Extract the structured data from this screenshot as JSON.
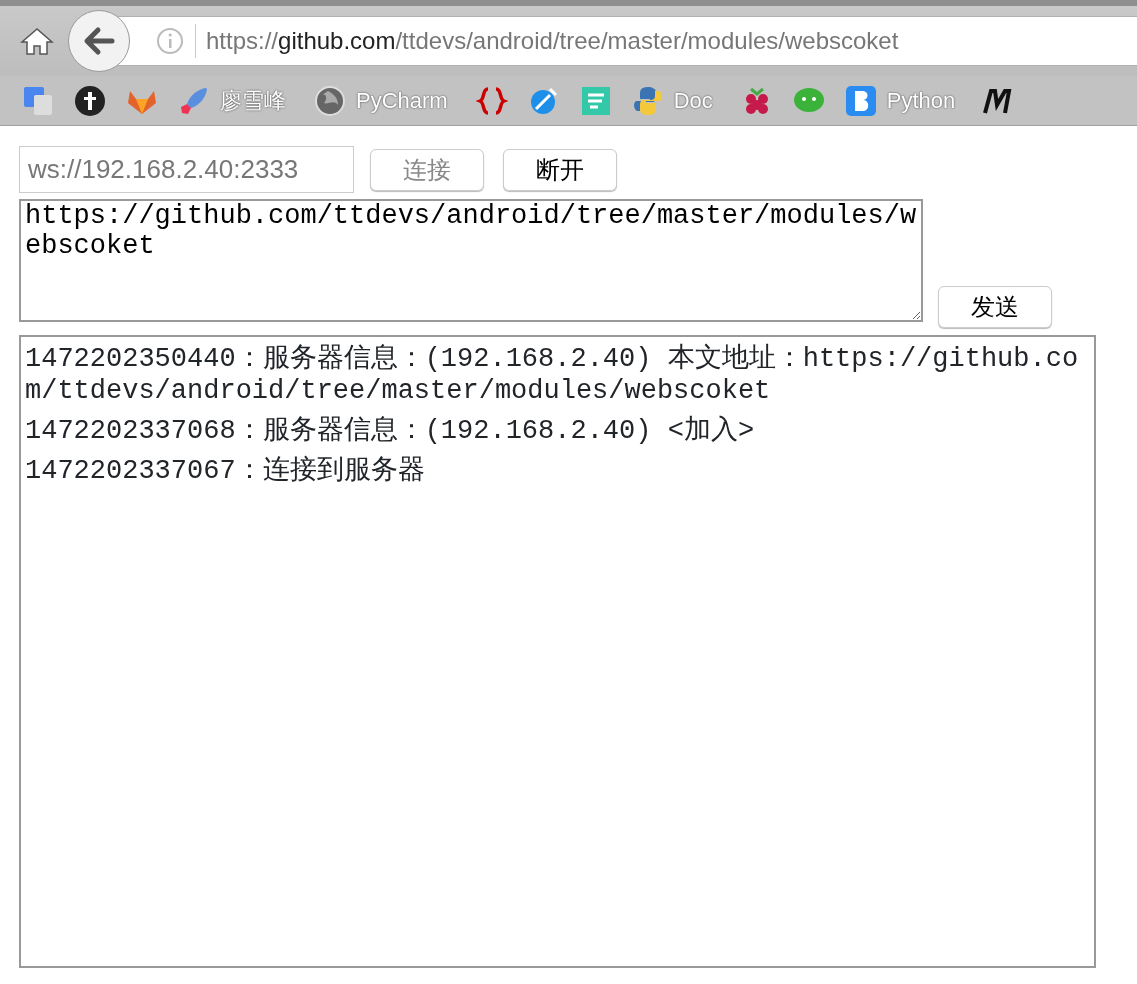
{
  "browser": {
    "url": {
      "scheme": "https://",
      "host": "github.com",
      "path": "/ttdevs/android/tree/master/modules/webscoket"
    },
    "bookmarks": [
      {
        "kind": "icon"
      },
      {
        "kind": "icon"
      },
      {
        "kind": "icon"
      },
      {
        "kind": "labeled",
        "label": "廖雪峰"
      },
      {
        "kind": "labeled",
        "label": "PyCharm"
      },
      {
        "kind": "icon"
      },
      {
        "kind": "icon"
      },
      {
        "kind": "icon"
      },
      {
        "kind": "labeled",
        "label": "Doc"
      },
      {
        "kind": "icon"
      },
      {
        "kind": "icon"
      },
      {
        "kind": "labeled",
        "label": "Python"
      },
      {
        "kind": "icon"
      }
    ]
  },
  "server_field": {
    "value": "ws://192.168.2.40:2333",
    "disabled": true
  },
  "buttons": [
    {
      "label": "连接",
      "disabled": true
    },
    {
      "label": "断开",
      "disabled": false
    }
  ],
  "message_field": {
    "value": "https://github.com/ttdevs/android/tree/master/modules/webscoket"
  },
  "send_button": {
    "label": "发送"
  },
  "log": [
    {
      "text": "1472202350440：服务器信息：(192.168.2.40) 本文地址：https://github.com/ttdevs/android/tree/master/modules/webscoket"
    },
    {
      "text": "1472202337068：服务器信息：(192.168.2.40) <加入>"
    },
    {
      "text": "1472202337067：连接到服务器"
    }
  ]
}
